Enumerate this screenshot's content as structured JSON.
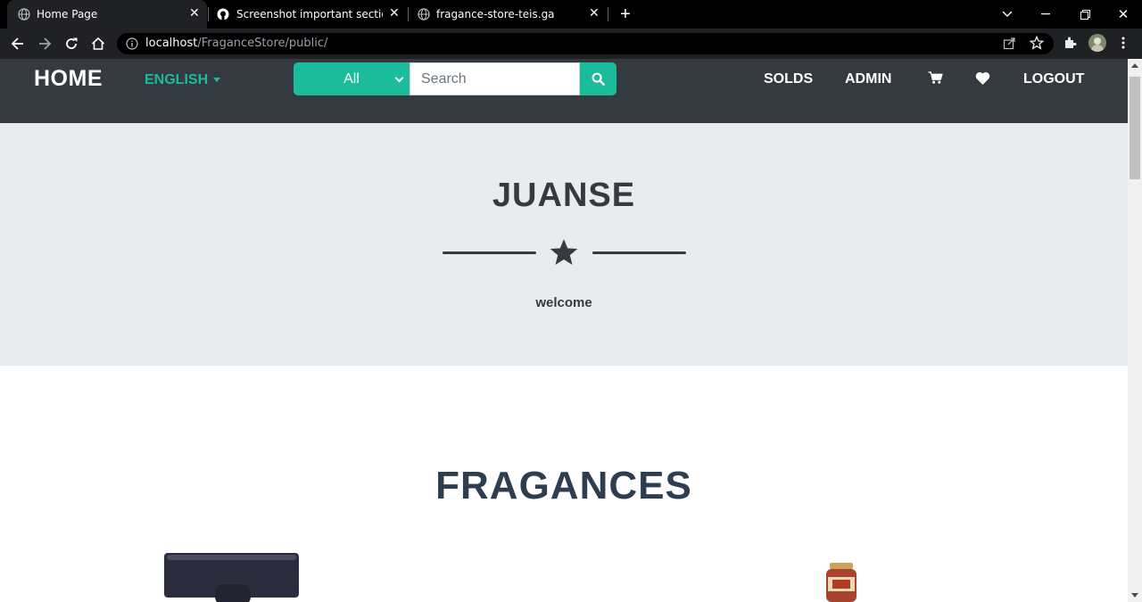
{
  "browser": {
    "tabs": [
      {
        "title": "Home Page",
        "active": true
      },
      {
        "title": "Screenshot important section · m",
        "active": false
      },
      {
        "title": "fragance-store-teis.ga",
        "active": false
      }
    ],
    "url_host": "localhost",
    "url_path": "/FraganceStore/public/"
  },
  "navbar": {
    "brand": "HOME",
    "language": "ENGLISH",
    "search_category": "All",
    "search_placeholder": "Search",
    "links": [
      "SOLDS",
      "ADMIN",
      "LOGOUT"
    ]
  },
  "masthead": {
    "title": "JUANSE",
    "subtitle": "welcome"
  },
  "section": {
    "title": "FRAGANCES"
  },
  "colors": {
    "accent": "#1abc9c",
    "navbar": "#343a40",
    "masthead": "#e9ecef",
    "heading": "#2c3e50"
  }
}
